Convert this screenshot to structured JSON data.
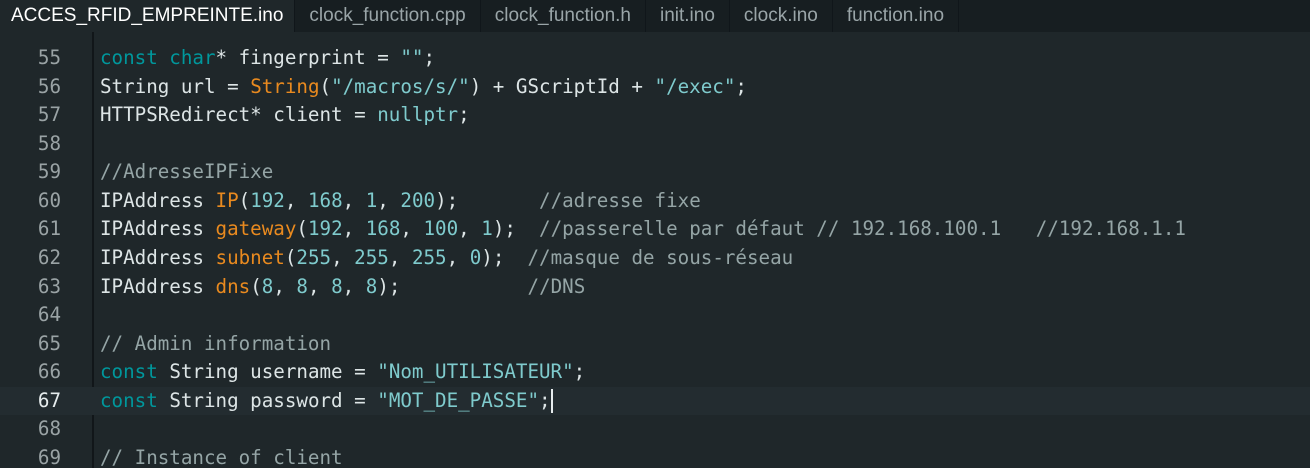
{
  "tabs": [
    {
      "label": "ACCES_RFID_EMPREINTE.ino",
      "active": true
    },
    {
      "label": "clock_function.cpp"
    },
    {
      "label": "clock_function.h"
    },
    {
      "label": "init.ino"
    },
    {
      "label": "clock.ino"
    },
    {
      "label": "function.ino"
    }
  ],
  "colors": {
    "background": "#1f272a",
    "keyword": "#00979c",
    "function": "#e98a1f",
    "literal": "#7fcbcd",
    "comment": "#95a5a6"
  },
  "current_line": 67,
  "lines": [
    {
      "n": 55,
      "tokens": [
        {
          "c": "k",
          "t": "const char"
        },
        {
          "c": "p",
          "t": "* fingerprint = "
        },
        {
          "c": "s",
          "t": "\"\""
        },
        {
          "c": "p",
          "t": ";"
        }
      ]
    },
    {
      "n": 56,
      "tokens": [
        {
          "c": "p",
          "t": "String url = "
        },
        {
          "c": "f",
          "t": "String"
        },
        {
          "c": "p",
          "t": "("
        },
        {
          "c": "s",
          "t": "\"/macros/s/\""
        },
        {
          "c": "p",
          "t": ") + GScriptId + "
        },
        {
          "c": "s",
          "t": "\"/exec\""
        },
        {
          "c": "p",
          "t": ";"
        }
      ]
    },
    {
      "n": 57,
      "tokens": [
        {
          "c": "p",
          "t": "HTTPSRedirect* client = "
        },
        {
          "c": "n",
          "t": "nullptr"
        },
        {
          "c": "p",
          "t": ";"
        }
      ]
    },
    {
      "n": 58,
      "tokens": []
    },
    {
      "n": 59,
      "tokens": [
        {
          "c": "c",
          "t": "//AdresseIPFixe"
        }
      ]
    },
    {
      "n": 60,
      "tokens": [
        {
          "c": "p",
          "t": "IPAddress "
        },
        {
          "c": "f",
          "t": "IP"
        },
        {
          "c": "p",
          "t": "("
        },
        {
          "c": "n",
          "t": "192"
        },
        {
          "c": "p",
          "t": ", "
        },
        {
          "c": "n",
          "t": "168"
        },
        {
          "c": "p",
          "t": ", "
        },
        {
          "c": "n",
          "t": "1"
        },
        {
          "c": "p",
          "t": ", "
        },
        {
          "c": "n",
          "t": "200"
        },
        {
          "c": "p",
          "t": ");       "
        },
        {
          "c": "c",
          "t": "//adresse fixe"
        }
      ]
    },
    {
      "n": 61,
      "tokens": [
        {
          "c": "p",
          "t": "IPAddress "
        },
        {
          "c": "f",
          "t": "gateway"
        },
        {
          "c": "p",
          "t": "("
        },
        {
          "c": "n",
          "t": "192"
        },
        {
          "c": "p",
          "t": ", "
        },
        {
          "c": "n",
          "t": "168"
        },
        {
          "c": "p",
          "t": ", "
        },
        {
          "c": "n",
          "t": "100"
        },
        {
          "c": "p",
          "t": ", "
        },
        {
          "c": "n",
          "t": "1"
        },
        {
          "c": "p",
          "t": ");  "
        },
        {
          "c": "c",
          "t": "//passerelle par défaut // 192.168.100.1   //192.168.1.1"
        }
      ]
    },
    {
      "n": 62,
      "tokens": [
        {
          "c": "p",
          "t": "IPAddress "
        },
        {
          "c": "f",
          "t": "subnet"
        },
        {
          "c": "p",
          "t": "("
        },
        {
          "c": "n",
          "t": "255"
        },
        {
          "c": "p",
          "t": ", "
        },
        {
          "c": "n",
          "t": "255"
        },
        {
          "c": "p",
          "t": ", "
        },
        {
          "c": "n",
          "t": "255"
        },
        {
          "c": "p",
          "t": ", "
        },
        {
          "c": "n",
          "t": "0"
        },
        {
          "c": "p",
          "t": ");  "
        },
        {
          "c": "c",
          "t": "//masque de sous-réseau"
        }
      ]
    },
    {
      "n": 63,
      "tokens": [
        {
          "c": "p",
          "t": "IPAddress "
        },
        {
          "c": "f",
          "t": "dns"
        },
        {
          "c": "p",
          "t": "("
        },
        {
          "c": "n",
          "t": "8"
        },
        {
          "c": "p",
          "t": ", "
        },
        {
          "c": "n",
          "t": "8"
        },
        {
          "c": "p",
          "t": ", "
        },
        {
          "c": "n",
          "t": "8"
        },
        {
          "c": "p",
          "t": ", "
        },
        {
          "c": "n",
          "t": "8"
        },
        {
          "c": "p",
          "t": ");           "
        },
        {
          "c": "c",
          "t": "//DNS"
        }
      ]
    },
    {
      "n": 64,
      "tokens": []
    },
    {
      "n": 65,
      "tokens": [
        {
          "c": "c",
          "t": "// Admin information"
        }
      ]
    },
    {
      "n": 66,
      "tokens": [
        {
          "c": "k",
          "t": "const"
        },
        {
          "c": "p",
          "t": " String username = "
        },
        {
          "c": "s",
          "t": "\"Nom_UTILISATEUR\""
        },
        {
          "c": "p",
          "t": ";"
        }
      ]
    },
    {
      "n": 67,
      "tokens": [
        {
          "c": "k",
          "t": "const"
        },
        {
          "c": "p",
          "t": " String password = "
        },
        {
          "c": "s",
          "t": "\"MOT_DE_PASSE\""
        },
        {
          "c": "p",
          "t": ";"
        }
      ]
    },
    {
      "n": 68,
      "tokens": []
    },
    {
      "n": 69,
      "tokens": [
        {
          "c": "c",
          "t": "// Instance of client"
        }
      ]
    }
  ]
}
